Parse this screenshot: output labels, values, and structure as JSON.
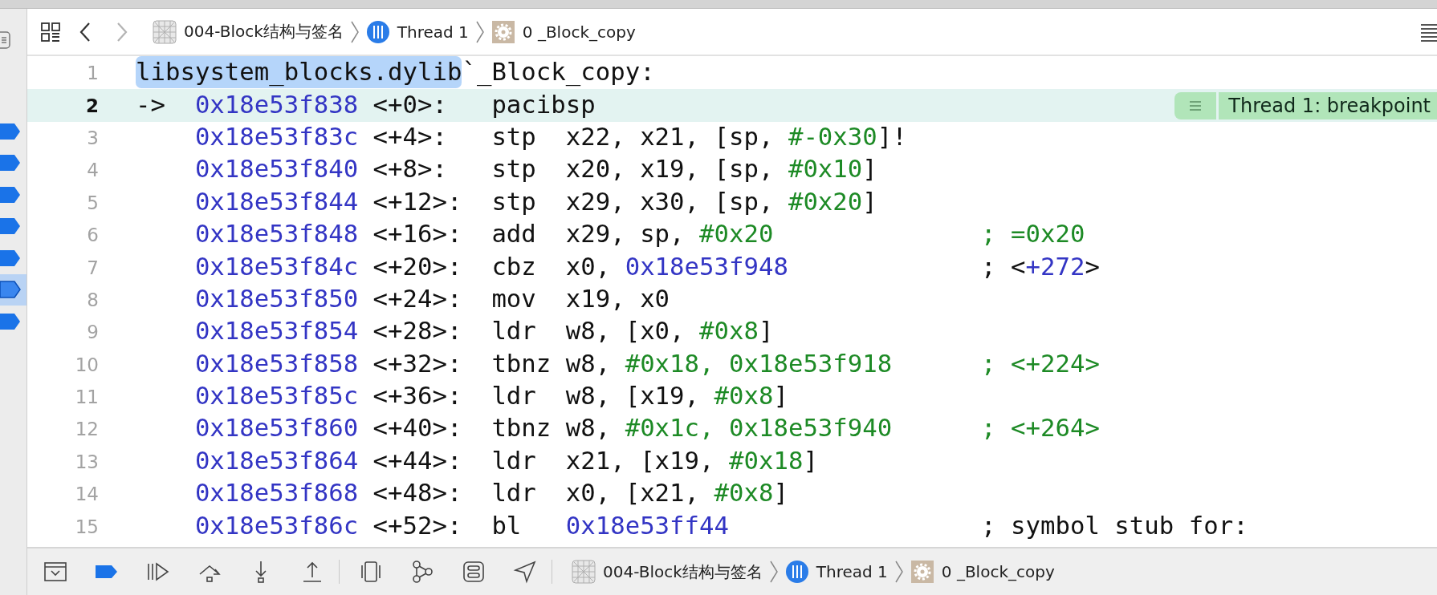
{
  "sidebar": {
    "breakpoints": [
      {
        "selected": false
      },
      {
        "selected": false
      },
      {
        "selected": false
      },
      {
        "selected": false
      },
      {
        "selected": false
      },
      {
        "selected": true
      },
      {
        "selected": false
      }
    ]
  },
  "jump_bar": {
    "buttons": [
      {
        "kind": "related",
        "disabled": false
      },
      {
        "kind": "back",
        "disabled": false
      },
      {
        "kind": "forward",
        "disabled": true
      }
    ],
    "breadcrumb": [
      {
        "kind": "project",
        "label": "004-Block结构与签名"
      },
      {
        "kind": "thread",
        "label": "Thread 1"
      },
      {
        "kind": "frame",
        "label": "0 _Block_copy"
      }
    ]
  },
  "code": {
    "lines": [
      {
        "number": "1",
        "current": false,
        "label": [
          {
            "text": "libsystem_blocks.dylib",
            "kind": "selection"
          },
          {
            "text": "`_Block_copy:",
            "kind": "plain"
          }
        ]
      },
      {
        "number": "2",
        "current": true,
        "arrow": "->",
        "address": "0x18e53f838",
        "offset": "<+0>:",
        "mnemonic": "pacibsp",
        "annotation": "Thread 1: breakpoint"
      },
      {
        "number": "3",
        "current": false,
        "address": "0x18e53f83c",
        "offset": "<+4>:",
        "mnemonic": "stp",
        "operands": [
          {
            "text": "x22, x21, [sp, ",
            "kind": "plain"
          },
          {
            "text": "#-0x30",
            "kind": "imm"
          },
          {
            "text": "]!",
            "kind": "plain"
          }
        ]
      },
      {
        "number": "4",
        "current": false,
        "address": "0x18e53f840",
        "offset": "<+8>:",
        "mnemonic": "stp",
        "operands": [
          {
            "text": "x20, x19, [sp, ",
            "kind": "plain"
          },
          {
            "text": "#0x10",
            "kind": "imm"
          },
          {
            "text": "]",
            "kind": "plain"
          }
        ]
      },
      {
        "number": "5",
        "current": false,
        "address": "0x18e53f844",
        "offset": "<+12>:",
        "mnemonic": "stp",
        "operands": [
          {
            "text": "x29, x30, [sp, ",
            "kind": "plain"
          },
          {
            "text": "#0x20",
            "kind": "imm"
          },
          {
            "text": "]",
            "kind": "plain"
          }
        ]
      },
      {
        "number": "6",
        "current": false,
        "address": "0x18e53f848",
        "offset": "<+16>:",
        "mnemonic": "add",
        "operands": [
          {
            "text": "x29, sp, ",
            "kind": "plain"
          },
          {
            "text": "#0x20",
            "kind": "imm"
          }
        ],
        "comment": [
          {
            "text": "; =0x20",
            "kind": "imm"
          }
        ]
      },
      {
        "number": "7",
        "current": false,
        "address": "0x18e53f84c",
        "offset": "<+20>:",
        "mnemonic": "cbz",
        "operands": [
          {
            "text": "x0, ",
            "kind": "plain"
          },
          {
            "text": "0x18e53f948",
            "kind": "addr"
          }
        ],
        "comment": [
          {
            "text": "; <",
            "kind": "plain"
          },
          {
            "text": "+272",
            "kind": "addr"
          },
          {
            "text": ">",
            "kind": "plain"
          }
        ]
      },
      {
        "number": "8",
        "current": false,
        "address": "0x18e53f850",
        "offset": "<+24>:",
        "mnemonic": "mov",
        "operands": [
          {
            "text": "x19, x0",
            "kind": "plain"
          }
        ]
      },
      {
        "number": "9",
        "current": false,
        "address": "0x18e53f854",
        "offset": "<+28>:",
        "mnemonic": "ldr",
        "operands": [
          {
            "text": "w8, [x0, ",
            "kind": "plain"
          },
          {
            "text": "#0x8",
            "kind": "imm"
          },
          {
            "text": "]",
            "kind": "plain"
          }
        ]
      },
      {
        "number": "10",
        "current": false,
        "address": "0x18e53f858",
        "offset": "<+32>:",
        "mnemonic": "tbnz",
        "operands": [
          {
            "text": "w8, ",
            "kind": "plain"
          },
          {
            "text": "#0x18, 0x18e53f918",
            "kind": "imm"
          }
        ],
        "comment": [
          {
            "text": "; <+224>",
            "kind": "imm"
          }
        ]
      },
      {
        "number": "11",
        "current": false,
        "address": "0x18e53f85c",
        "offset": "<+36>:",
        "mnemonic": "ldr",
        "operands": [
          {
            "text": "w8, [x19, ",
            "kind": "plain"
          },
          {
            "text": "#0x8",
            "kind": "imm"
          },
          {
            "text": "]",
            "kind": "plain"
          }
        ]
      },
      {
        "number": "12",
        "current": false,
        "address": "0x18e53f860",
        "offset": "<+40>:",
        "mnemonic": "tbnz",
        "operands": [
          {
            "text": "w8, ",
            "kind": "plain"
          },
          {
            "text": "#0x1c, 0x18e53f940",
            "kind": "imm"
          }
        ],
        "comment": [
          {
            "text": "; <+264>",
            "kind": "imm"
          }
        ]
      },
      {
        "number": "13",
        "current": false,
        "address": "0x18e53f864",
        "offset": "<+44>:",
        "mnemonic": "ldr",
        "operands": [
          {
            "text": "x21, [x19, ",
            "kind": "plain"
          },
          {
            "text": "#0x18",
            "kind": "imm"
          },
          {
            "text": "]",
            "kind": "plain"
          }
        ]
      },
      {
        "number": "14",
        "current": false,
        "address": "0x18e53f868",
        "offset": "<+48>:",
        "mnemonic": "ldr",
        "operands": [
          {
            "text": "x0, [x21, ",
            "kind": "plain"
          },
          {
            "text": "#0x8",
            "kind": "imm"
          },
          {
            "text": "]",
            "kind": "plain"
          }
        ]
      },
      {
        "number": "15",
        "current": false,
        "address": "0x18e53f86c",
        "offset": "<+52>:",
        "mnemonic": "bl",
        "operands": [
          {
            "text": "0x18e53ff44",
            "kind": "addr"
          }
        ],
        "comment": [
          {
            "text": "; symbol stub for:",
            "kind": "plain"
          }
        ]
      }
    ]
  },
  "debug_bar": {
    "groups": [
      [
        {
          "kind": "console"
        },
        {
          "kind": "breakpoints",
          "on": true
        },
        {
          "kind": "continue"
        },
        {
          "kind": "step_over"
        },
        {
          "kind": "step_into"
        },
        {
          "kind": "step_out"
        }
      ],
      [
        {
          "kind": "view_debugger"
        },
        {
          "kind": "memory_graph"
        },
        {
          "kind": "environment"
        },
        {
          "kind": "location"
        }
      ]
    ],
    "breadcrumb": [
      {
        "kind": "project",
        "label": "004-Block结构与签名"
      },
      {
        "kind": "thread",
        "label": "Thread 1"
      },
      {
        "kind": "frame",
        "label": "0 _Block_copy"
      }
    ]
  }
}
